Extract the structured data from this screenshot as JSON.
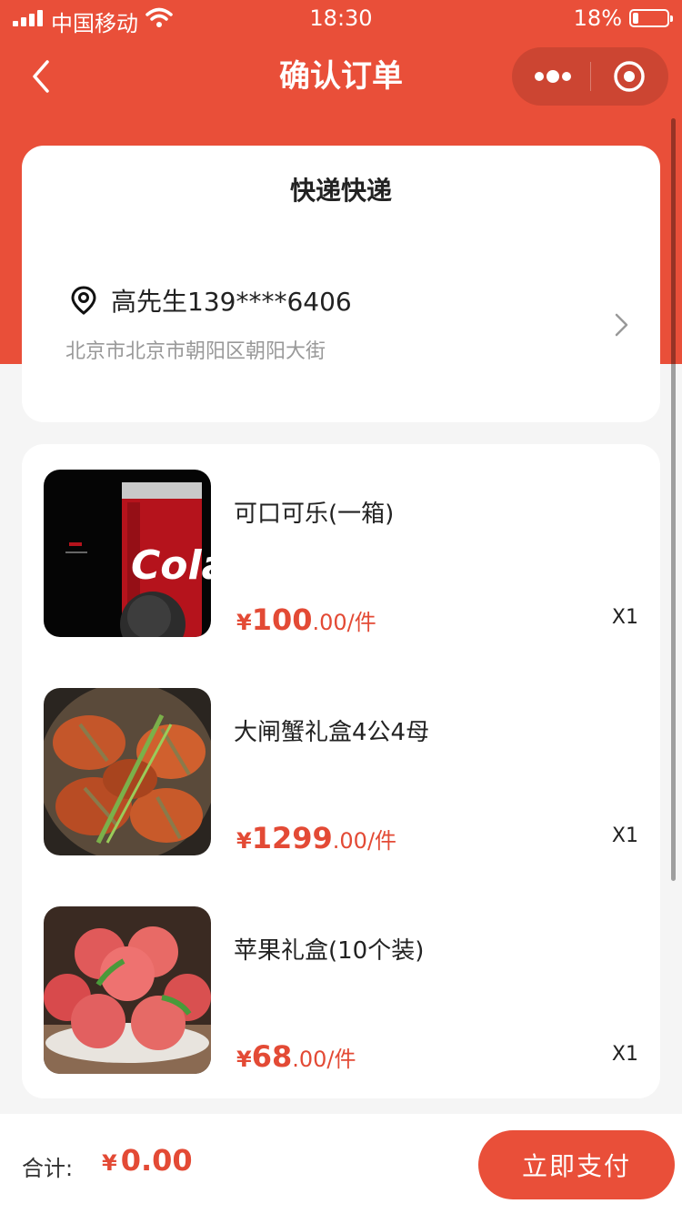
{
  "colors": {
    "accent": "#e94f39",
    "price": "#e34a35"
  },
  "status_bar": {
    "carrier": "中国移动",
    "time": "18:30",
    "battery_percent": "18%",
    "battery_level": 0.18
  },
  "nav": {
    "title": "确认订单",
    "back_icon": "chevron-left-icon",
    "more_icon": "more-dots-icon",
    "close_icon": "target-circle-icon"
  },
  "delivery": {
    "method_label": "快递快递",
    "contact": "高先生139****6406",
    "address": "北京市北京市朝阳区朝阳大街"
  },
  "products": [
    {
      "name": "可口可乐(一箱)",
      "currency": "¥",
      "price_int": "100",
      "price_dec": ".00",
      "unit": "/件",
      "qty": "X1",
      "image": "cola-can"
    },
    {
      "name": "大闸蟹礼盒4公4母",
      "currency": "¥",
      "price_int": "1299",
      "price_dec": ".00",
      "unit": "/件",
      "qty": "X1",
      "image": "hairy-crabs"
    },
    {
      "name": "苹果礼盒(10个装)",
      "currency": "¥",
      "price_int": "68",
      "price_dec": ".00",
      "unit": "/件",
      "qty": "X1",
      "image": "apples"
    }
  ],
  "footer": {
    "total_label": "合计:",
    "currency": "¥",
    "total_value": "0.00",
    "pay_label": "立即支付"
  }
}
